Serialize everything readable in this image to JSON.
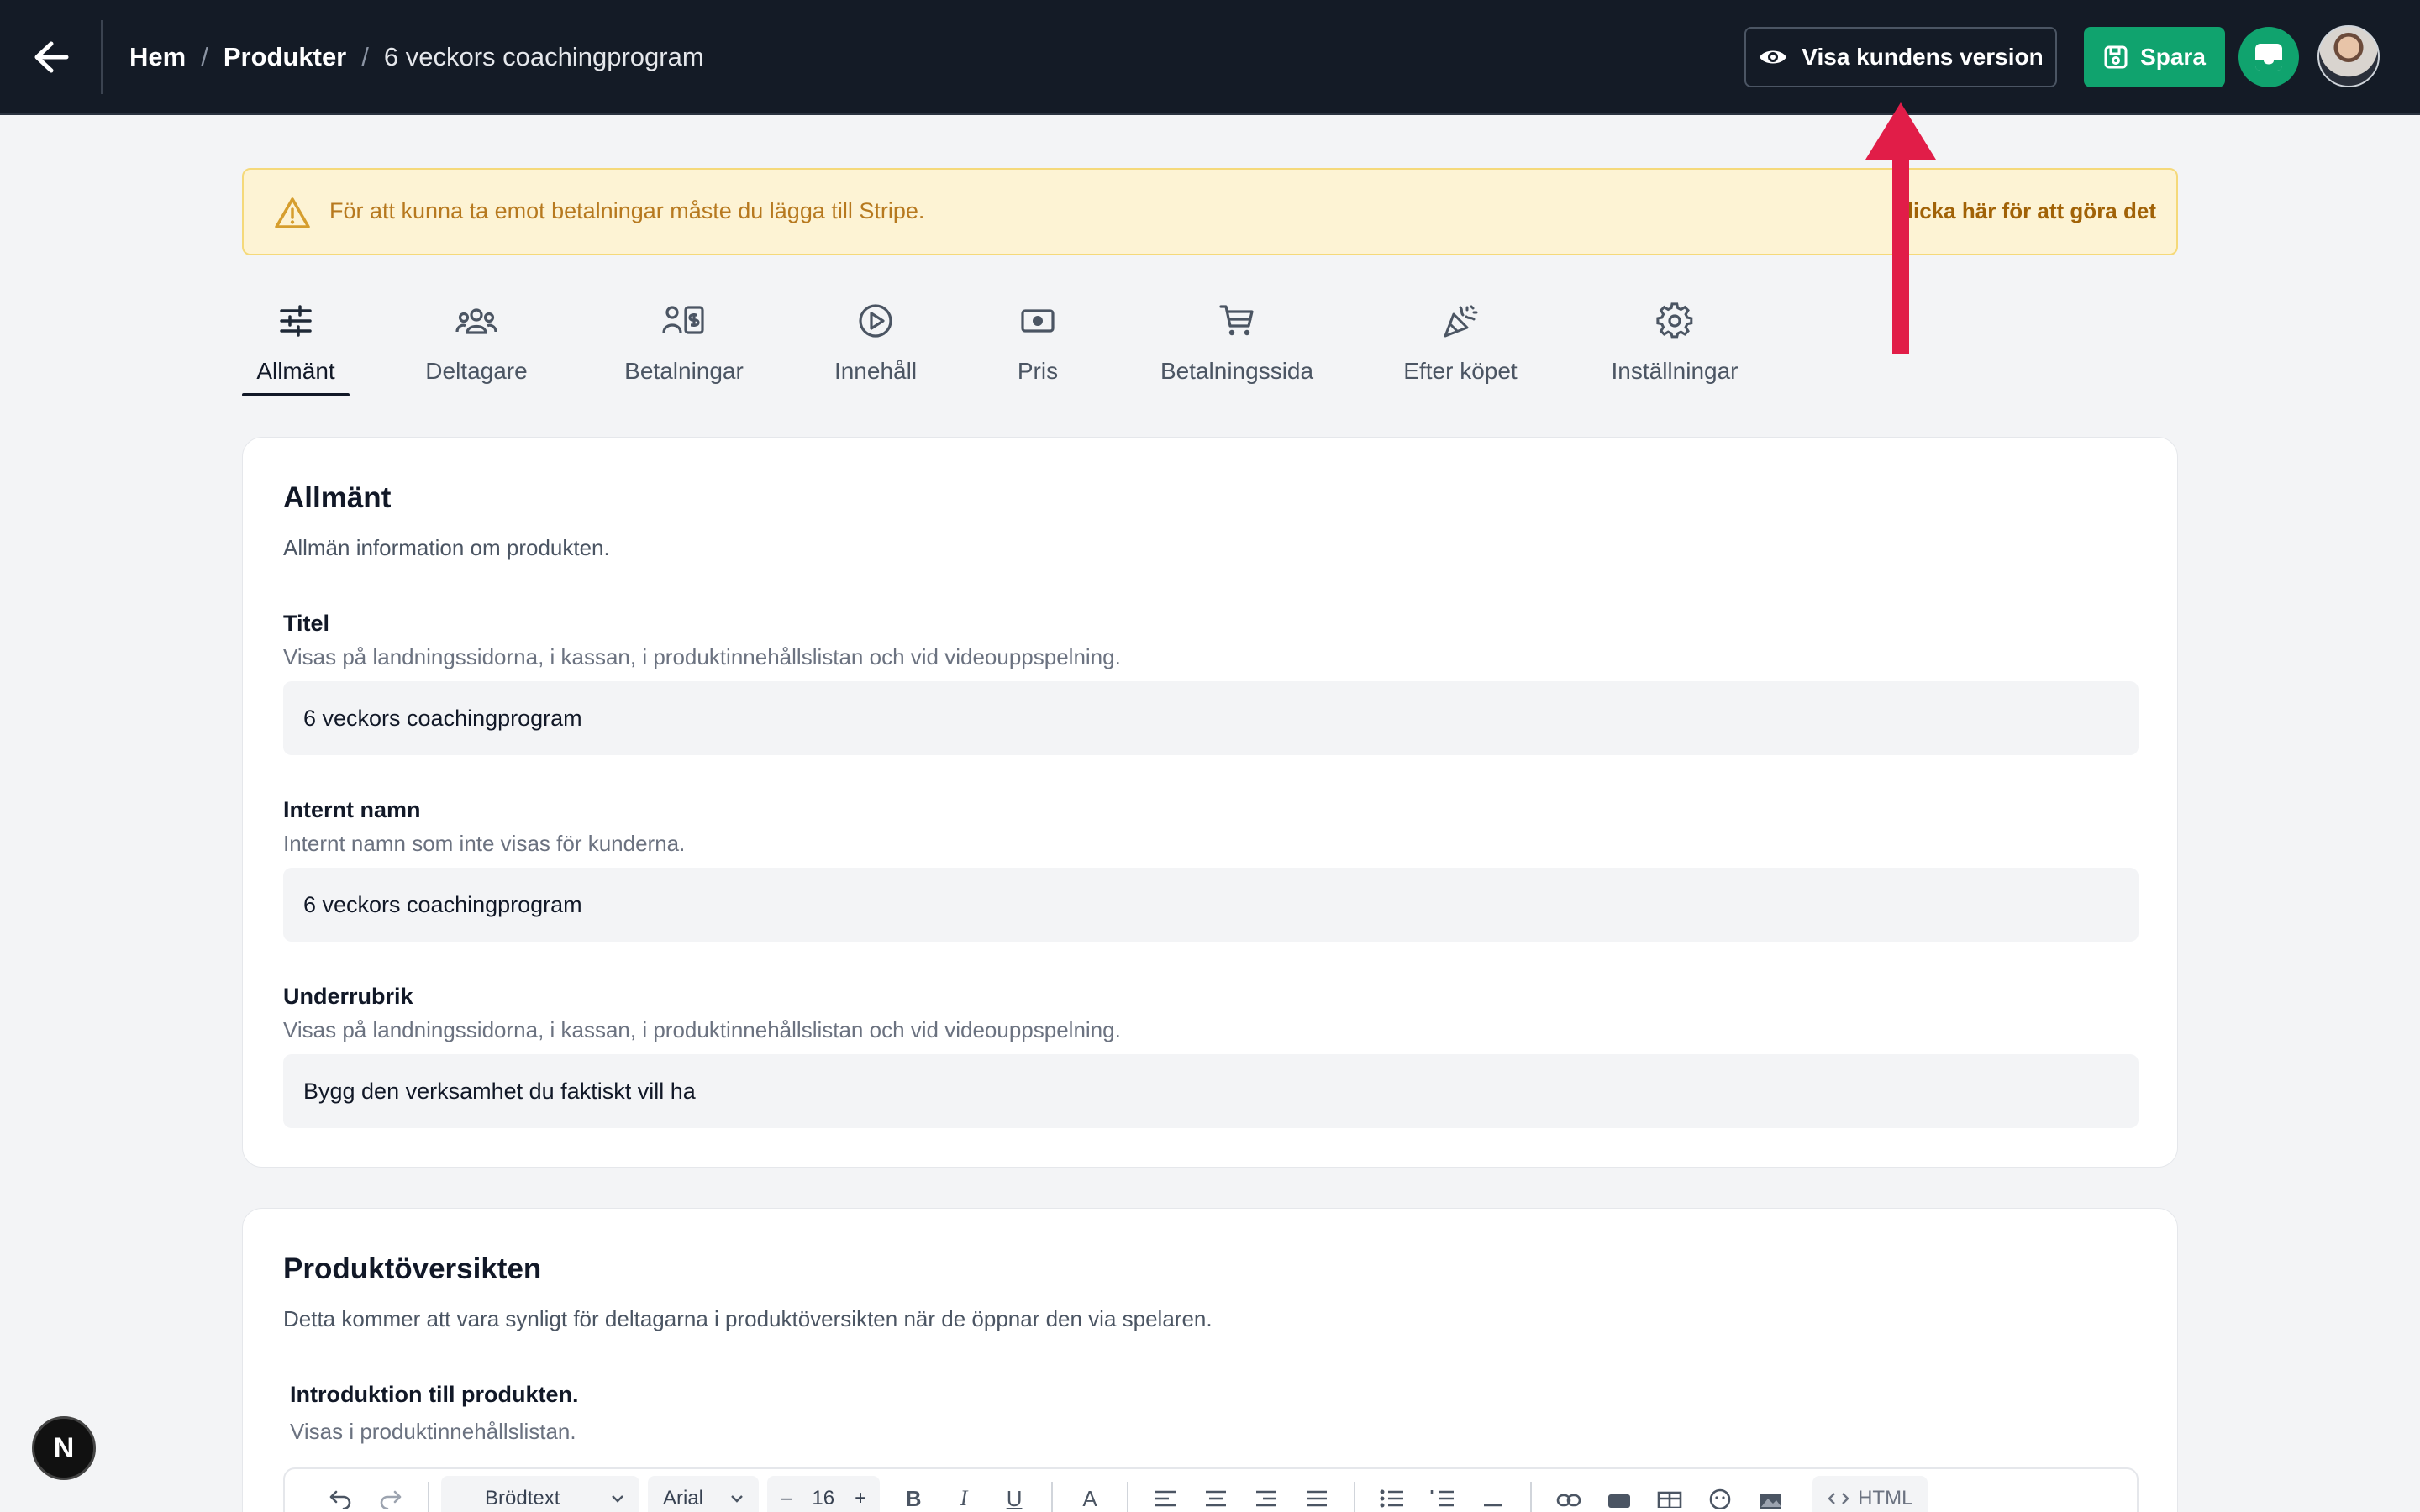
{
  "topbar": {
    "breadcrumb": [
      "Hem",
      "Produkter",
      "6 veckors coachingprogram"
    ],
    "separator": "/",
    "visa_label": "Visa kundens version",
    "spara_label": "Spara"
  },
  "banner": {
    "text": "För att kunna ta emot betalningar måste du lägga till Stripe.",
    "link": "Klicka här för att göra det"
  },
  "tabs": [
    {
      "label": "Allmänt",
      "icon": "sliders-icon",
      "active": true
    },
    {
      "label": "Deltagare",
      "icon": "users-icon"
    },
    {
      "label": "Betalningar",
      "icon": "payments-icon"
    },
    {
      "label": "Innehåll",
      "icon": "play-circle-icon"
    },
    {
      "label": "Pris",
      "icon": "banknote-icon"
    },
    {
      "label": "Betalningssida",
      "icon": "cart-icon"
    },
    {
      "label": "Efter köpet",
      "icon": "party-popper-icon"
    },
    {
      "label": "Inställningar",
      "icon": "gear-icon"
    }
  ],
  "general": {
    "title": "Allmänt",
    "description": "Allmän information om produkten.",
    "fields": [
      {
        "label": "Titel",
        "help": "Visas på landningssidorna, i kassan, i produktinnehållslistan och vid videouppspelning.",
        "value": "6 veckors coachingprogram"
      },
      {
        "label": "Internt namn",
        "help": "Internt namn som inte visas för kunderna.",
        "value": "6 veckors coachingprogram"
      },
      {
        "label": "Underrubrik",
        "help": "Visas på landningssidorna, i kassan, i produktinnehållslistan och vid videouppspelning.",
        "value": "Bygg den verksamhet du faktiskt vill ha"
      }
    ]
  },
  "overview": {
    "title": "Produktöversikten",
    "description": "Detta kommer att vara synligt för deltagarna i produktöversikten när de öppnar den via spelaren.",
    "intro_label": "Introduktion till produkten.",
    "intro_help": "Visas i produktinnehållslistan.",
    "toolbar": {
      "block_style": "Brödtext",
      "font": "Arial",
      "font_size": "16",
      "minus": "–",
      "plus": "+",
      "bold": "B",
      "italic": "I",
      "underline": "U",
      "color": "A",
      "html_label": "HTML"
    }
  },
  "badge": {
    "letter": "N"
  },
  "colors": {
    "accent": "#10a36e",
    "topbar": "#141b26",
    "annotation": "#e11d48",
    "warning": "#b7791f"
  }
}
